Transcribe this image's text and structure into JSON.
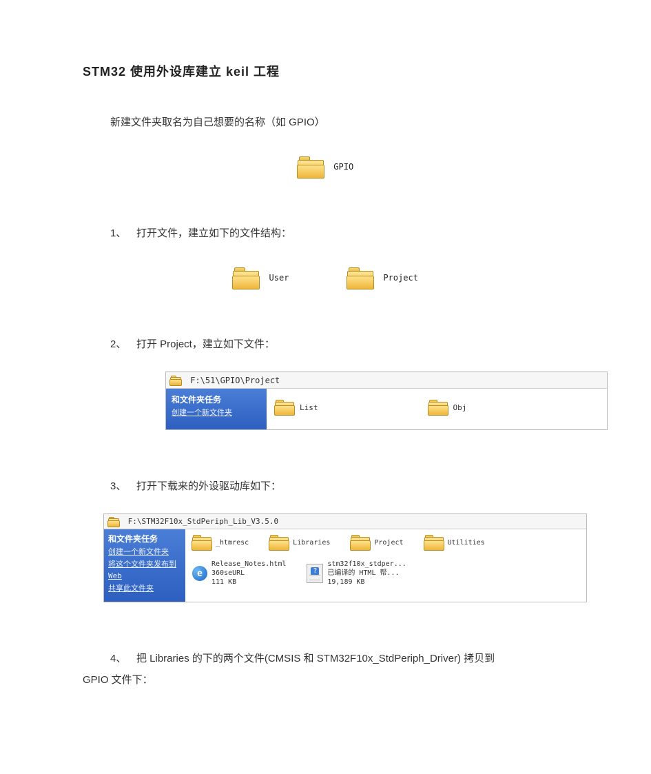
{
  "title": "STM32 使用外设库建立 keil 工程",
  "intro": "新建文件夹取名为自己想要的名称（如 GPIO）",
  "gpio_label": "GPIO",
  "step1": {
    "num": "1、",
    "text": "打开文件，建立如下的文件结构："
  },
  "step1_folders": {
    "user": "User",
    "project": "Project"
  },
  "step2": {
    "num": "2、",
    "text": "打开 Project，建立如下文件："
  },
  "step2_win": {
    "address": "F:\\51\\GPIO\\Project",
    "side_title": "和文件夹任务",
    "side_link": "创建一个新文件夹",
    "list": "List",
    "obj": "Obj"
  },
  "step3": {
    "num": "3、",
    "text": "打开下载来的外设驱动库如下："
  },
  "step3_win": {
    "address": "F:\\STM32F10x_StdPeriph_Lib_V3.5.0",
    "side_title": "和文件夹任务",
    "side_link1": "创建一个新文件夹",
    "side_link2": "将这个文件夹发布到 Web",
    "side_link3": "共享此文件夹",
    "htmresc": "_htmresc",
    "libraries": "Libraries",
    "project": "Project",
    "utilities": "Utilities",
    "release_main": "Release_Notes.html",
    "release_sub": "360seURL",
    "release_size": "111 KB",
    "chm_main": "stm32f10x_stdper...",
    "chm_sub": "已编译的 HTML 帮...",
    "chm_size": "19,189 KB"
  },
  "step4": {
    "num": "4、",
    "text": "把 Libraries 的下的两个文件(CMSIS 和 STM32F10x_StdPeriph_Driver) 拷贝到"
  },
  "step4_cont": "GPIO 文件下："
}
